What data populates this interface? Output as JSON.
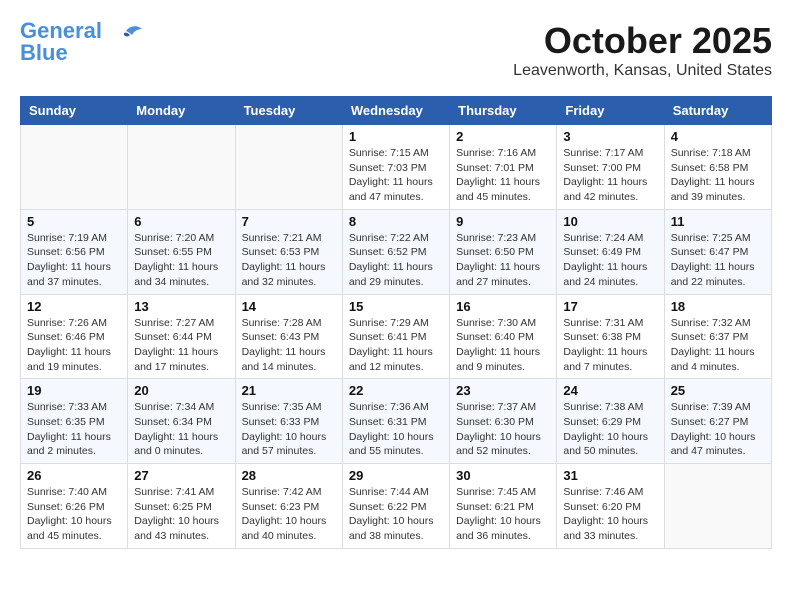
{
  "header": {
    "logo_line1": "General",
    "logo_line2": "Blue",
    "month": "October 2025",
    "location": "Leavenworth, Kansas, United States"
  },
  "weekdays": [
    "Sunday",
    "Monday",
    "Tuesday",
    "Wednesday",
    "Thursday",
    "Friday",
    "Saturday"
  ],
  "weeks": [
    [
      {
        "day": "",
        "info": ""
      },
      {
        "day": "",
        "info": ""
      },
      {
        "day": "",
        "info": ""
      },
      {
        "day": "1",
        "info": "Sunrise: 7:15 AM\nSunset: 7:03 PM\nDaylight: 11 hours\nand 47 minutes."
      },
      {
        "day": "2",
        "info": "Sunrise: 7:16 AM\nSunset: 7:01 PM\nDaylight: 11 hours\nand 45 minutes."
      },
      {
        "day": "3",
        "info": "Sunrise: 7:17 AM\nSunset: 7:00 PM\nDaylight: 11 hours\nand 42 minutes."
      },
      {
        "day": "4",
        "info": "Sunrise: 7:18 AM\nSunset: 6:58 PM\nDaylight: 11 hours\nand 39 minutes."
      }
    ],
    [
      {
        "day": "5",
        "info": "Sunrise: 7:19 AM\nSunset: 6:56 PM\nDaylight: 11 hours\nand 37 minutes."
      },
      {
        "day": "6",
        "info": "Sunrise: 7:20 AM\nSunset: 6:55 PM\nDaylight: 11 hours\nand 34 minutes."
      },
      {
        "day": "7",
        "info": "Sunrise: 7:21 AM\nSunset: 6:53 PM\nDaylight: 11 hours\nand 32 minutes."
      },
      {
        "day": "8",
        "info": "Sunrise: 7:22 AM\nSunset: 6:52 PM\nDaylight: 11 hours\nand 29 minutes."
      },
      {
        "day": "9",
        "info": "Sunrise: 7:23 AM\nSunset: 6:50 PM\nDaylight: 11 hours\nand 27 minutes."
      },
      {
        "day": "10",
        "info": "Sunrise: 7:24 AM\nSunset: 6:49 PM\nDaylight: 11 hours\nand 24 minutes."
      },
      {
        "day": "11",
        "info": "Sunrise: 7:25 AM\nSunset: 6:47 PM\nDaylight: 11 hours\nand 22 minutes."
      }
    ],
    [
      {
        "day": "12",
        "info": "Sunrise: 7:26 AM\nSunset: 6:46 PM\nDaylight: 11 hours\nand 19 minutes."
      },
      {
        "day": "13",
        "info": "Sunrise: 7:27 AM\nSunset: 6:44 PM\nDaylight: 11 hours\nand 17 minutes."
      },
      {
        "day": "14",
        "info": "Sunrise: 7:28 AM\nSunset: 6:43 PM\nDaylight: 11 hours\nand 14 minutes."
      },
      {
        "day": "15",
        "info": "Sunrise: 7:29 AM\nSunset: 6:41 PM\nDaylight: 11 hours\nand 12 minutes."
      },
      {
        "day": "16",
        "info": "Sunrise: 7:30 AM\nSunset: 6:40 PM\nDaylight: 11 hours\nand 9 minutes."
      },
      {
        "day": "17",
        "info": "Sunrise: 7:31 AM\nSunset: 6:38 PM\nDaylight: 11 hours\nand 7 minutes."
      },
      {
        "day": "18",
        "info": "Sunrise: 7:32 AM\nSunset: 6:37 PM\nDaylight: 11 hours\nand 4 minutes."
      }
    ],
    [
      {
        "day": "19",
        "info": "Sunrise: 7:33 AM\nSunset: 6:35 PM\nDaylight: 11 hours\nand 2 minutes."
      },
      {
        "day": "20",
        "info": "Sunrise: 7:34 AM\nSunset: 6:34 PM\nDaylight: 11 hours\nand 0 minutes."
      },
      {
        "day": "21",
        "info": "Sunrise: 7:35 AM\nSunset: 6:33 PM\nDaylight: 10 hours\nand 57 minutes."
      },
      {
        "day": "22",
        "info": "Sunrise: 7:36 AM\nSunset: 6:31 PM\nDaylight: 10 hours\nand 55 minutes."
      },
      {
        "day": "23",
        "info": "Sunrise: 7:37 AM\nSunset: 6:30 PM\nDaylight: 10 hours\nand 52 minutes."
      },
      {
        "day": "24",
        "info": "Sunrise: 7:38 AM\nSunset: 6:29 PM\nDaylight: 10 hours\nand 50 minutes."
      },
      {
        "day": "25",
        "info": "Sunrise: 7:39 AM\nSunset: 6:27 PM\nDaylight: 10 hours\nand 47 minutes."
      }
    ],
    [
      {
        "day": "26",
        "info": "Sunrise: 7:40 AM\nSunset: 6:26 PM\nDaylight: 10 hours\nand 45 minutes."
      },
      {
        "day": "27",
        "info": "Sunrise: 7:41 AM\nSunset: 6:25 PM\nDaylight: 10 hours\nand 43 minutes."
      },
      {
        "day": "28",
        "info": "Sunrise: 7:42 AM\nSunset: 6:23 PM\nDaylight: 10 hours\nand 40 minutes."
      },
      {
        "day": "29",
        "info": "Sunrise: 7:44 AM\nSunset: 6:22 PM\nDaylight: 10 hours\nand 38 minutes."
      },
      {
        "day": "30",
        "info": "Sunrise: 7:45 AM\nSunset: 6:21 PM\nDaylight: 10 hours\nand 36 minutes."
      },
      {
        "day": "31",
        "info": "Sunrise: 7:46 AM\nSunset: 6:20 PM\nDaylight: 10 hours\nand 33 minutes."
      },
      {
        "day": "",
        "info": ""
      }
    ]
  ]
}
